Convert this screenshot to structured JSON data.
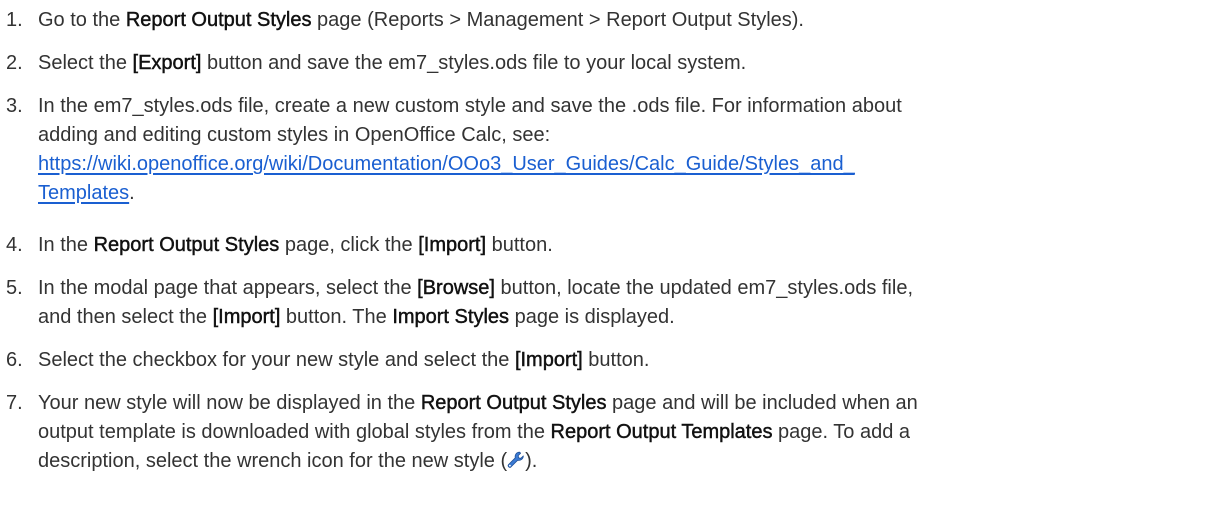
{
  "steps": [
    {
      "number": "1.",
      "parts": [
        "Go to the ",
        "Report Output Styles",
        " page (Reports > Management > Report Output Styles)."
      ]
    },
    {
      "number": "2.",
      "parts": [
        "Select the ",
        "[Export]",
        " button and save the em7_styles.ods file to your local system."
      ]
    },
    {
      "number": "3.",
      "line1": "In the em7_styles.ods file, create a new custom style and save the .ods file. For information about",
      "line2": "adding and editing custom styles in OpenOffice Calc, see:",
      "link_line1": "https://wiki.openoffice.org/wiki/Documentation/OOo3_User_Guides/Calc_Guide/Styles_and_",
      "link_line2": "Templates",
      "after_link": "."
    },
    {
      "number": "4.",
      "parts": [
        "In the ",
        "Report Output Styles",
        " page, click the ",
        "[Import]",
        " button."
      ]
    },
    {
      "number": "5.",
      "line1_parts": [
        "In the modal page that appears, select the ",
        "[Browse]",
        " button, locate the updated em7_styles.ods file,"
      ],
      "line2_parts": [
        "and then select the ",
        "[Import]",
        " button. The ",
        "Import Styles",
        " page is displayed."
      ]
    },
    {
      "number": "6.",
      "parts": [
        "Select the checkbox for your new style and select the ",
        "[Import]",
        " button."
      ]
    },
    {
      "number": "7.",
      "line1_parts": [
        "Your new style will now be displayed in the ",
        "Report Output Styles",
        " page and will be included when an"
      ],
      "line2_parts": [
        "output template is downloaded with global styles from the ",
        "Report Output Templates",
        " page. To add a"
      ],
      "line3_parts": [
        "description, select the wrench icon for the new style (",
        ")."
      ],
      "icon": "wrench-icon"
    }
  ],
  "colors": {
    "text": "#333333",
    "link": "#1a5fd1",
    "icon": "#3b7bd4"
  }
}
